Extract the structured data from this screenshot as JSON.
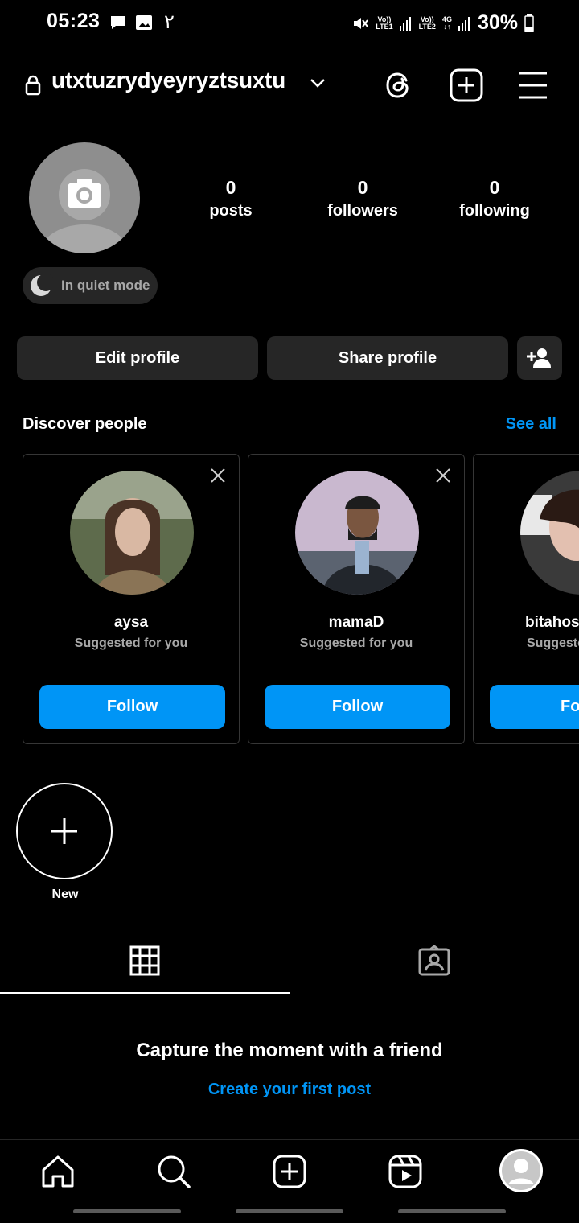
{
  "status_bar": {
    "time": "05:23",
    "extra_indicator": "٢",
    "sim1": [
      "Vo))",
      "LTE1"
    ],
    "sim2": [
      "Vo))",
      "LTE2"
    ],
    "network": "4G",
    "battery": "30%"
  },
  "header": {
    "username": "utxtuzrydyeyryztsuxtu",
    "icons": [
      "lock-icon",
      "chevron-down-icon",
      "threads-icon",
      "create-icon",
      "menu-icon"
    ]
  },
  "profile": {
    "stats": [
      {
        "value": "0",
        "label": "posts"
      },
      {
        "value": "0",
        "label": "followers"
      },
      {
        "value": "0",
        "label": "following"
      }
    ],
    "quiet_mode": "In quiet mode",
    "edit_button": "Edit profile",
    "share_button": "Share profile"
  },
  "discover": {
    "title": "Discover people",
    "see_all": "See all",
    "cards": [
      {
        "name": "aysa",
        "subtitle": "Suggested for you",
        "button": "Follow"
      },
      {
        "name": "mamaD",
        "subtitle": "Suggested for you",
        "button": "Follow"
      },
      {
        "name": "bitahos",
        "subtitle": "Suggeste",
        "button": "Fo"
      }
    ]
  },
  "highlights": {
    "new_label": "New"
  },
  "empty_state": {
    "title": "Capture the moment with a friend",
    "link": "Create your first post"
  },
  "colors": {
    "accent": "#0095f6",
    "background": "#000000",
    "surface": "#262626"
  }
}
